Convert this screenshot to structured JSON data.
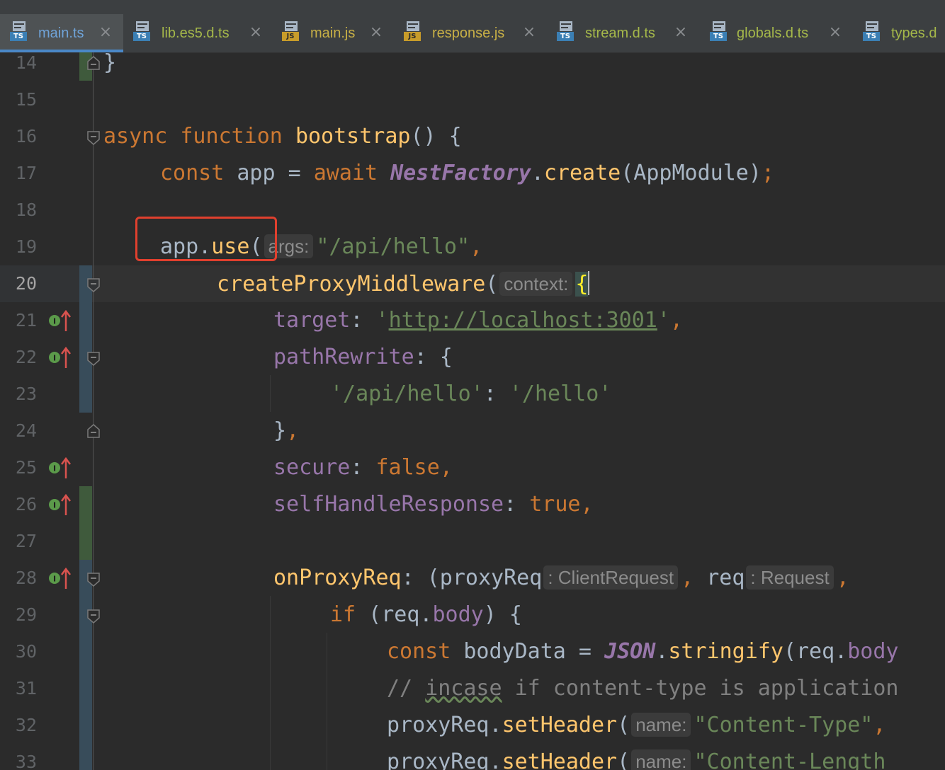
{
  "tabs": [
    {
      "name": "main.ts",
      "type": "TS",
      "active": true
    },
    {
      "name": "lib.es5.d.ts",
      "type": "TS"
    },
    {
      "name": "main.js",
      "type": "JS"
    },
    {
      "name": "response.js",
      "type": "JS"
    },
    {
      "name": "stream.d.ts",
      "type": "TS"
    },
    {
      "name": "globals.d.ts",
      "type": "TS"
    },
    {
      "name": "types.d",
      "type": "TS"
    }
  ],
  "tab_close_glyph": "×",
  "editor": {
    "current_line": "20",
    "line_numbers": [
      "14",
      "15",
      "16",
      "17",
      "18",
      "19",
      "20",
      "21",
      "22",
      "23",
      "24",
      "25",
      "26",
      "27",
      "28",
      "29",
      "30",
      "31",
      "32",
      "33"
    ],
    "code": {
      "l14_brace": "}",
      "l16_async": "async",
      "l16_function": "function",
      "l16_name": "bootstrap",
      "l16_rest": "() {",
      "l17_const": "const",
      "l17_app": " app = ",
      "l17_await": "await",
      "l17_class": "NestFactory",
      "l17_dot": ".",
      "l17_create": "create",
      "l17_args": "(AppModule)",
      "l17_semi": ";",
      "l19_app": "app.",
      "l19_use": "use",
      "l19_paren": "(",
      "l19_hint": "args:",
      "l19_str": "\"/api/hello\"",
      "l19_comma": ",",
      "l20_fn": "createProxyMiddleware",
      "l20_paren": "(",
      "l20_hint": "context:",
      "l20_brace": "{",
      "l21_key": "target",
      "l21_colon": ": ",
      "l21_q1": "'",
      "l21_url": "http://localhost:3001",
      "l21_q2": "'",
      "l21_comma": ",",
      "l22_key": "pathRewrite",
      "l22_rest": ": {",
      "l23_k": "'/api/hello'",
      "l23_colon": ": ",
      "l23_v": "'/hello'",
      "l24_brace": "}",
      "l24_comma": ",",
      "l25_key": "secure",
      "l25_colon": ": ",
      "l25_val": "false",
      "l25_comma": ",",
      "l26_key": "selfHandleResponse",
      "l26_colon": ": ",
      "l26_val": "true",
      "l26_comma": ",",
      "l28_key": "onProxyReq",
      "l28_rest": ": (proxyReq",
      "l28_hint1": ": ClientRequest",
      "l28_comma": ",",
      "l28_req": " req",
      "l28_hint2": ": Request",
      "l28_tail": ",",
      "l29_if": "if",
      "l29_open": " (req.",
      "l29_body": "body",
      "l29_close": ") {",
      "l30_const": "const",
      "l30_mid": " bodyData = ",
      "l30_cls": "JSON",
      "l30_dot": ".",
      "l30_fn": "stringify",
      "l30_arg": "(req.",
      "l30_body": "body",
      "l31_c1": "// ",
      "l31_incase": "incase",
      "l31_c2": " if content-type is application",
      "l32_obj": "proxyReq.",
      "l32_fn": "setHeader",
      "l32_paren": "(",
      "l32_hint": "name:",
      "l32_str": "\"Content-Type\"",
      "l32_comma": ",",
      "l33_obj": "proxyReq.",
      "l33_fn": "setHeader",
      "l33_paren": "(",
      "l33_hint": "name:",
      "l33_str": "\"Content-Length"
    }
  },
  "colors": {
    "background": "#2b2b2b",
    "keyword": "#cc7832",
    "function": "#ffc66d",
    "string": "#6a8759",
    "property": "#9876aa",
    "highlight_box": "#e0402e",
    "active_tab_underline": "#4a88c7"
  }
}
